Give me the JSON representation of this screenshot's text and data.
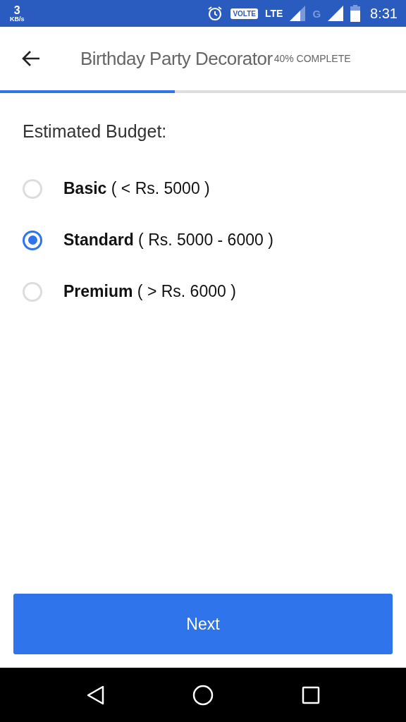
{
  "status_bar": {
    "speed_value": "3",
    "speed_unit": "KB/s",
    "volte": "VOLTE",
    "network": "LTE",
    "network_2": "G",
    "time": "8:31"
  },
  "header": {
    "title": "Birthday Party Decorator",
    "progress_label": "40% COMPLETE",
    "level": 0.43
  },
  "question": "Estimated Budget:",
  "options": [
    {
      "label": "**Basic** ( < Rs. 5000 )",
      "selected": false
    },
    {
      "label": "**Standard** ( Rs. 5000 - 6000 )",
      "selected": true
    },
    {
      "label": "**Premium** ( > Rs. 6000 )",
      "selected": false
    }
  ],
  "next_button": "Next"
}
